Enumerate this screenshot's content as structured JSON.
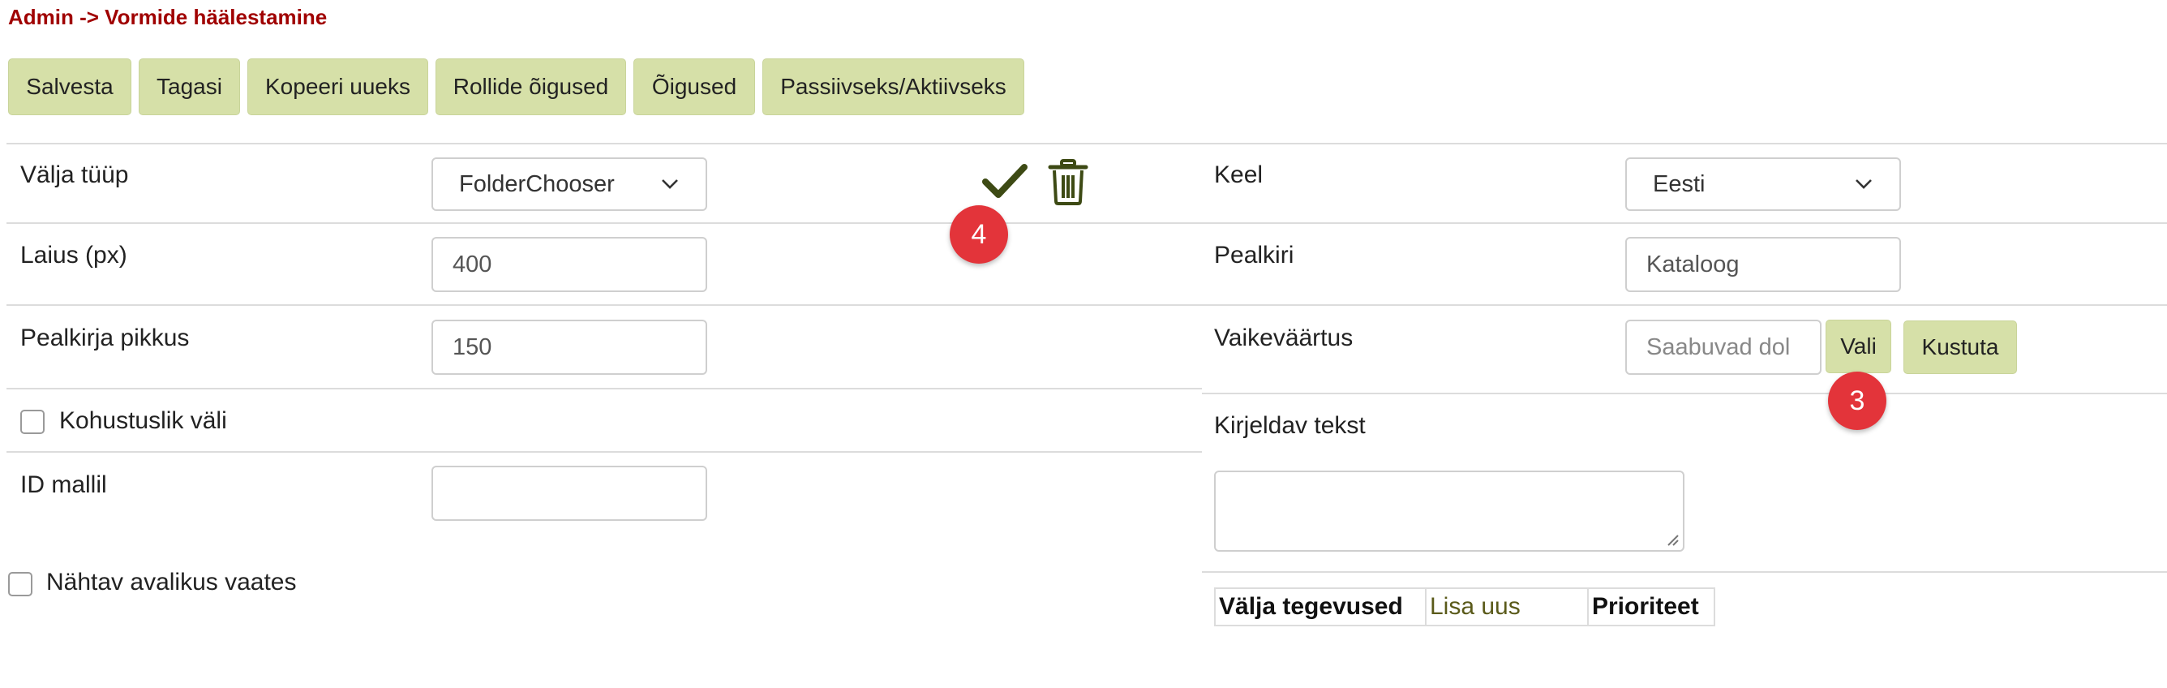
{
  "breadcrumb": "Admin -> Vormide häälestamine",
  "toolbar": {
    "save": "Salvesta",
    "back": "Tagasi",
    "copy_new": "Kopeeri uueks",
    "role_rights": "Rollide õigused",
    "rights": "Õigused",
    "toggle_active": "Passiivseks/Aktiivseks"
  },
  "left": {
    "field_type_label": "Välja tüüp",
    "field_type_value": "FolderChooser",
    "width_label": "Laius (px)",
    "width_value": "400",
    "title_length_label": "Pealkirja pikkus",
    "title_length_value": "150",
    "required_label": "Kohustuslik väli",
    "template_id_label": "ID mallil",
    "template_id_value": "",
    "public_view_label": "Nähtav avalikus vaates"
  },
  "right": {
    "language_label": "Keel",
    "language_value": "Eesti",
    "title_label": "Pealkiri",
    "title_value": "Kataloog",
    "default_label": "Vaikeväärtus",
    "default_value": "Saabuvad dol",
    "choose_button": "Vali",
    "delete_button": "Kustuta",
    "description_label": "Kirjeldav tekst",
    "actions_table": {
      "col_actions": "Välja tegevused",
      "add_new": "Lisa uus",
      "col_priority": "Prioriteet"
    }
  },
  "badges": {
    "confirm_badge": "4",
    "choose_badge": "3"
  },
  "icons": {
    "confirm": "checkmark-icon",
    "delete": "trash-icon",
    "dropdown": "chevron-down-icon"
  },
  "colors": {
    "breadcrumb": "#a00000",
    "button_bg": "#d6e0a8",
    "icon": "#3d4a14",
    "badge": "#e3343a"
  }
}
